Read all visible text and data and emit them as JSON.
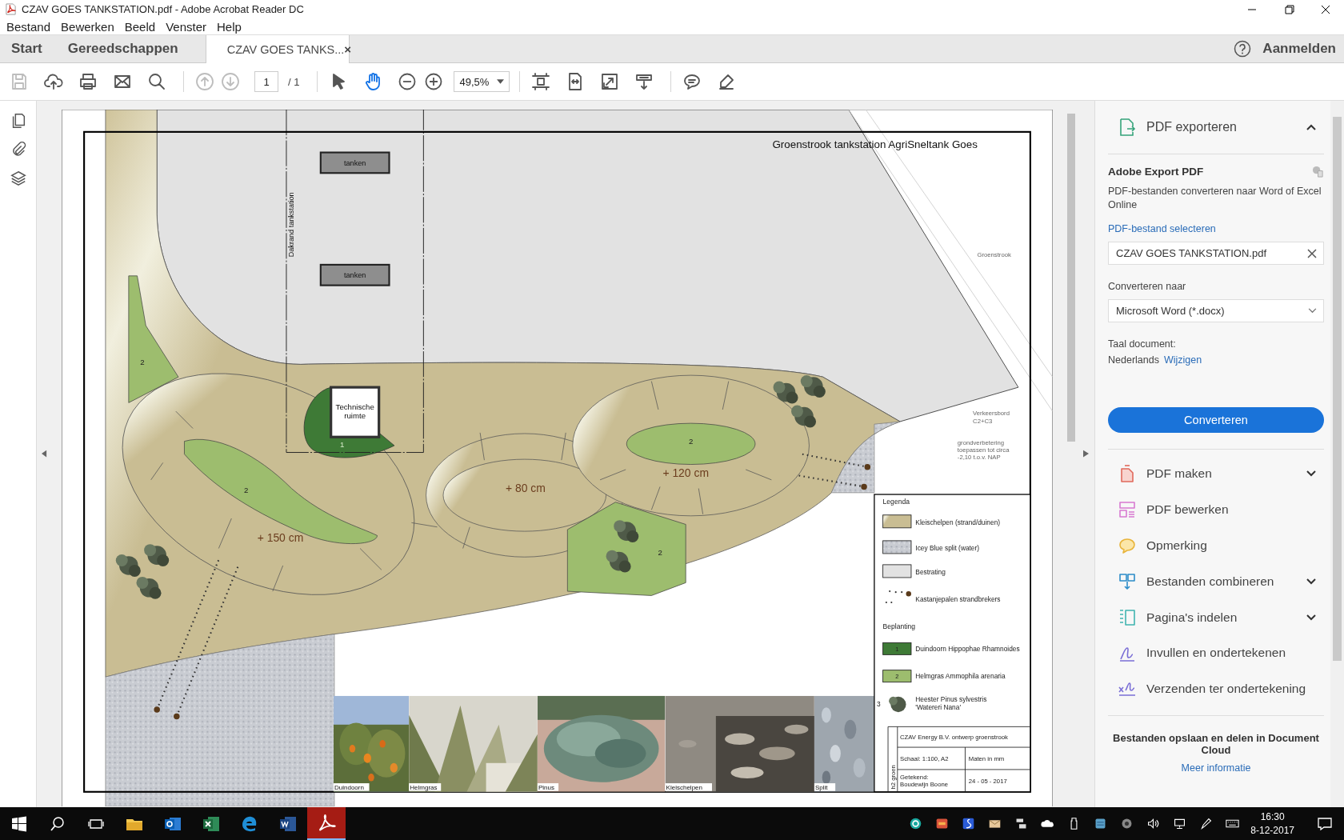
{
  "window": {
    "title": "CZAV GOES TANKSTATION.pdf - Adobe Acrobat Reader DC"
  },
  "menu": [
    "Bestand",
    "Bewerken",
    "Beeld",
    "Venster",
    "Help"
  ],
  "tabs": [
    {
      "label": "Start",
      "selected": false
    },
    {
      "label": "Gereedschappen",
      "selected": false
    },
    {
      "label": "CZAV GOES TANKS...",
      "selected": true,
      "close": "×"
    }
  ],
  "account": "Aanmelden",
  "toolbar": {
    "tools": [
      {
        "kind": "save",
        "disabled": true
      },
      {
        "kind": "upload",
        "disabled": false
      },
      {
        "kind": "print",
        "disabled": false
      },
      {
        "kind": "mail",
        "disabled": false
      },
      {
        "kind": "search",
        "disabled": false
      }
    ],
    "nav": [
      {
        "kind": "up",
        "disabled": true
      },
      {
        "kind": "down",
        "disabled": true
      }
    ],
    "page": "1",
    "page_count": "/ 1",
    "modes": [
      {
        "kind": "pointer",
        "selected": false
      },
      {
        "kind": "hand",
        "selected": true
      }
    ],
    "zoom": "49,5%",
    "view": [
      {
        "kind": "fitpage"
      },
      {
        "kind": "fitwidth"
      },
      {
        "kind": "fullscreen"
      },
      {
        "kind": "scroll"
      }
    ],
    "annotate": [
      {
        "kind": "comment"
      },
      {
        "kind": "pen"
      }
    ]
  },
  "drawing": {
    "title": "Groenstrook tankstation AgriSneltank Goes",
    "pumps": [
      "tanken",
      "tanken"
    ],
    "roof_label": "Dakrand tankstation",
    "room_label": [
      "Technische",
      "ruimte"
    ],
    "heights": [
      "+ 150 cm",
      "+ 80 cm",
      "+ 120 cm"
    ],
    "zones": [
      {
        "label": "2",
        "kind": "helmgras"
      },
      {
        "label": "2",
        "kind": "helmgras"
      },
      {
        "label": "2",
        "kind": "helmgras"
      },
      {
        "label": "2",
        "kind": "helmgras"
      },
      {
        "label": "1",
        "kind": "duindoorn"
      }
    ],
    "notes": [
      {
        "lines": [
          "Groenstrook"
        ]
      },
      {
        "lines": [
          "Verkeersbord",
          "C2+C3"
        ]
      },
      {
        "lines": [
          "grondverbetering",
          "toepassen tot circa",
          "-2,10 t.o.v. NAP"
        ]
      }
    ],
    "legend": {
      "title": "Legenda",
      "items": [
        {
          "kind": "sand",
          "label": "Kleischelpen (strand/duinen)"
        },
        {
          "kind": "gravel",
          "label": "Icey Blue split (water)"
        },
        {
          "kind": "paving",
          "label": "Bestrating"
        },
        {
          "kind": "poles",
          "label": "Kastanjepalen strandbrekers"
        }
      ],
      "planting_title": "Beplanting",
      "plants": [
        {
          "kind": "duindoorn",
          "number": "1",
          "lines": [
            "Duindoorn Hippophae Rhamnoides"
          ]
        },
        {
          "kind": "helmgras",
          "number": "2",
          "lines": [
            "Helmgras Ammophila arenaria"
          ]
        },
        {
          "kind": "shrub",
          "number": "3",
          "lines": [
            "Heester Pinus sylvestris",
            "'Watereri Nana'"
          ]
        }
      ]
    },
    "title_block": {
      "side": "h2 groen",
      "company": "CZAV Energy B.V. ontwerp groenstrook",
      "scale": "Schaal: 1:100, A2",
      "units": "Maten in mm",
      "drawn_by": [
        "Getekend:",
        "Boudewijn Boone"
      ],
      "date": "24 - 05 - 2017"
    },
    "photos": [
      {
        "kind": "berries",
        "caption": "Duindoorn"
      },
      {
        "kind": "grass",
        "caption": "Helmgras"
      },
      {
        "kind": "pine",
        "caption": "Pinus"
      },
      {
        "kind": "shells",
        "caption": "Kleischelpen"
      },
      {
        "kind": "gravel",
        "caption": "Split"
      }
    ]
  },
  "panel": {
    "header": {
      "label": "PDF exporteren",
      "expanded": true
    },
    "heading": "Adobe Export PDF",
    "description": "PDF-bestanden converteren naar Word of Excel Online",
    "select_link": "PDF-bestand selecteren",
    "file": "CZAV GOES TANKSTATION.pdf",
    "convert_label": "Converteren naar",
    "format": "Microsoft Word (*.docx)",
    "language_label": "Taal document:",
    "language": "Nederlands",
    "change_link": "Wijzigen",
    "convert_button": "Converteren",
    "tools": [
      {
        "kind": "create",
        "label": "PDF maken",
        "expandable": true
      },
      {
        "kind": "edit",
        "label": "PDF bewerken",
        "expandable": false
      },
      {
        "kind": "comment",
        "label": "Opmerking",
        "expandable": false
      },
      {
        "kind": "combine",
        "label": "Bestanden combineren",
        "expandable": true
      },
      {
        "kind": "organize",
        "label": "Pagina's indelen",
        "expandable": true
      },
      {
        "kind": "fill",
        "label": "Invullen en ondertekenen",
        "expandable": false
      },
      {
        "kind": "send",
        "label": "Verzenden ter ondertekening",
        "expandable": false
      }
    ],
    "footer": "Bestanden opslaan en delen in Document Cloud",
    "footer_link": "Meer informatie"
  },
  "taskbar": {
    "apps": [
      {
        "kind": "explorer",
        "active": false
      },
      {
        "kind": "outlook",
        "active": false
      },
      {
        "kind": "excel",
        "active": false
      },
      {
        "kind": "edge",
        "active": false
      },
      {
        "kind": "word",
        "active": false
      },
      {
        "kind": "acrobat",
        "active": true
      }
    ],
    "tray": [
      {
        "kind": "eset"
      },
      {
        "kind": "ccleaner"
      },
      {
        "kind": "snip"
      },
      {
        "kind": "mail"
      },
      {
        "kind": "network-share"
      },
      {
        "kind": "onedrive"
      },
      {
        "kind": "usb"
      },
      {
        "kind": "app"
      },
      {
        "kind": "speaker-device"
      },
      {
        "kind": "volume"
      },
      {
        "kind": "network"
      },
      {
        "kind": "pen"
      },
      {
        "kind": "keyboard"
      }
    ],
    "time": "16:30",
    "date": "8-12-2017"
  }
}
